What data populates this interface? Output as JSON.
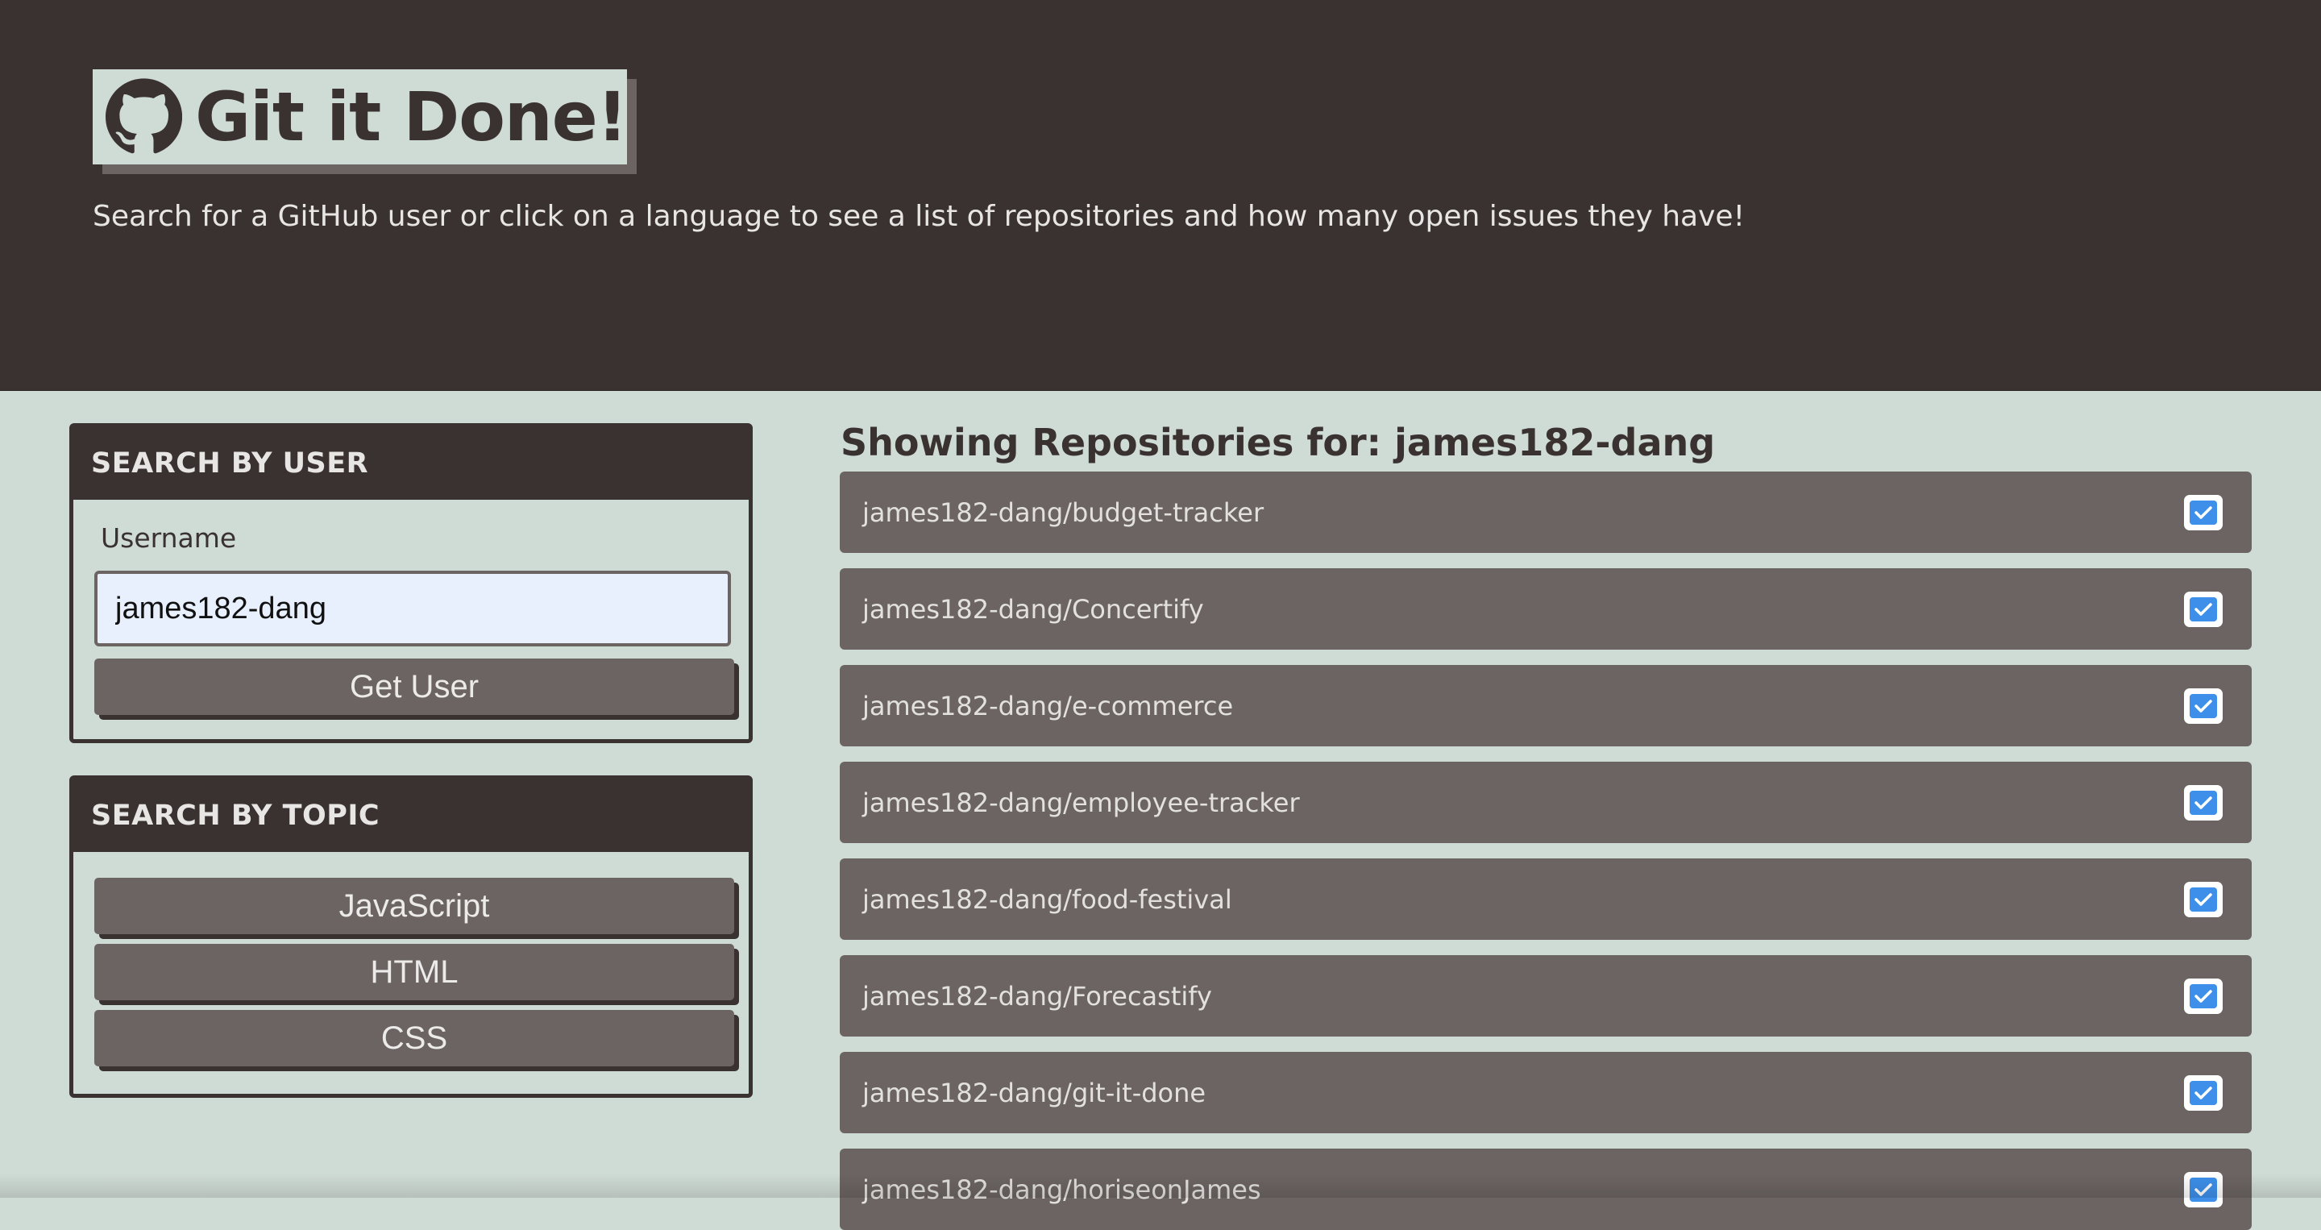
{
  "header": {
    "title": "Git it Done!",
    "logo_icon": "github-octocat-icon",
    "subtitle": "Search for a GitHub user or click on a language to see a list of repositories and how many open issues they have!"
  },
  "user_search": {
    "heading": "SEARCH BY USER",
    "username_label": "Username",
    "username_value": "james182-dang",
    "button_label": "Get User"
  },
  "topic_search": {
    "heading": "SEARCH BY TOPIC",
    "buttons": [
      "JavaScript",
      "HTML",
      "CSS"
    ]
  },
  "results": {
    "heading_prefix": "Showing Repositories for:",
    "heading_user": "james182-dang",
    "status_icon": "check-square-icon",
    "repos": [
      "james182-dang/budget-tracker",
      "james182-dang/Concertify",
      "james182-dang/e-commerce",
      "james182-dang/employee-tracker",
      "james182-dang/food-festival",
      "james182-dang/Forecastify",
      "james182-dang/git-it-done",
      "james182-dang/horiseonJames"
    ]
  },
  "colors": {
    "header_bg": "#3a3231",
    "page_bg": "#cfdbd5",
    "item_bg": "#6b6462",
    "check_blue": "#3d8fea",
    "input_bg": "#e8f0fe"
  }
}
